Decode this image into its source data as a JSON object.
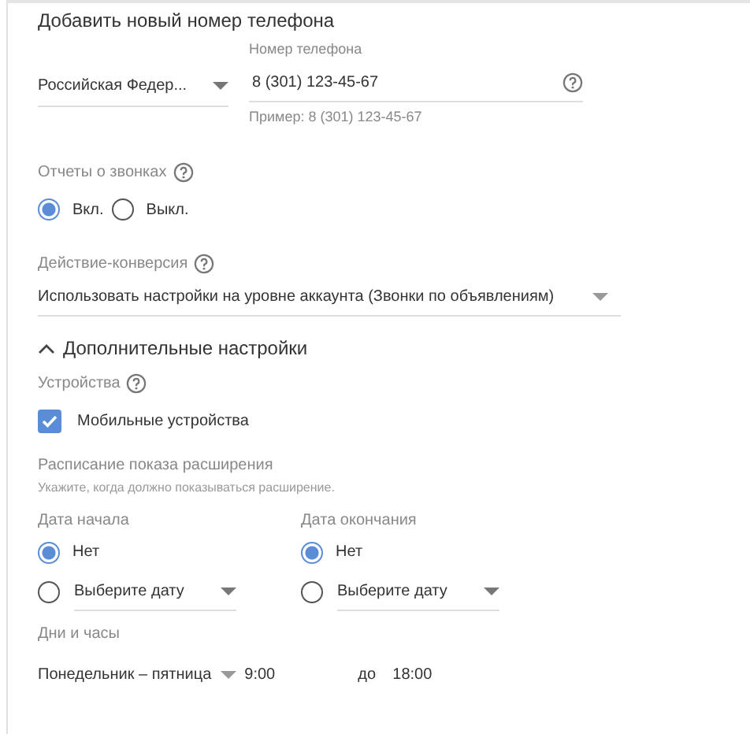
{
  "title": "Добавить новый номер телефона",
  "country": {
    "value": "Российская Федер..."
  },
  "phone": {
    "label": "Номер телефона",
    "value": "8 (301) 123-45-67",
    "hint": "Пример: 8 (301) 123-45-67"
  },
  "call_reports": {
    "label": "Отчеты о звонках",
    "options": [
      {
        "label": "Вкл.",
        "selected": true
      },
      {
        "label": "Выкл.",
        "selected": false
      }
    ]
  },
  "conversion": {
    "label": "Действие-конверсия",
    "value": "Использовать настройки на уровне аккаунта (Звонки по объявлениям)"
  },
  "advanced": {
    "title": "Дополнительные настройки",
    "expanded": true
  },
  "devices": {
    "label": "Устройства",
    "options": [
      {
        "label": "Мобильные устройства",
        "checked": true
      }
    ]
  },
  "schedule": {
    "label": "Расписание показа расширения",
    "hint": "Укажите, когда должно показываться расширение."
  },
  "dates": [
    {
      "label": "Дата начала",
      "options": [
        {
          "kind": "plain",
          "label": "Нет",
          "selected": true
        },
        {
          "kind": "dropdown",
          "label": "Выберите дату",
          "selected": false
        }
      ]
    },
    {
      "label": "Дата окончания",
      "options": [
        {
          "kind": "plain",
          "label": "Нет",
          "selected": true
        },
        {
          "kind": "dropdown",
          "label": "Выберите дату",
          "selected": false
        }
      ]
    }
  ],
  "days_hours": {
    "label": "Дни и часы",
    "days": "Понедельник – пятница",
    "from": "9:00",
    "separator": "до",
    "to": "18:00"
  }
}
